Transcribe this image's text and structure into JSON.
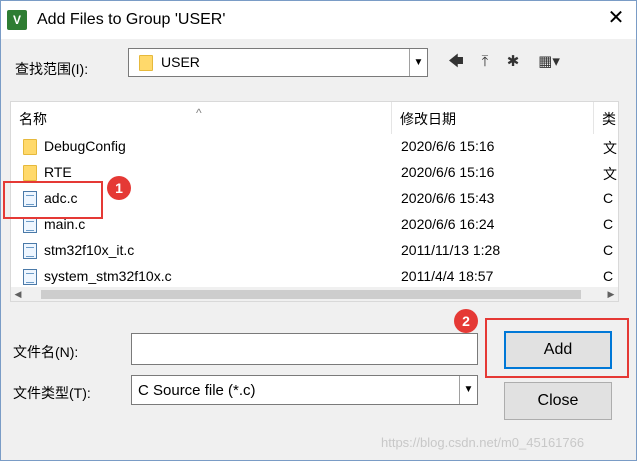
{
  "window": {
    "title": "Add Files to Group 'USER'",
    "close_glyph": "✕",
    "app_icon_glyph": "V"
  },
  "lookin": {
    "label": "查找范围(I):",
    "value": "USER",
    "arrow": "▼"
  },
  "toolbar": {
    "back_glyph": "🡄",
    "up_glyph": "⤒",
    "new_folder_glyph": "✱",
    "view_glyph": "▦▾"
  },
  "list": {
    "headers": {
      "name": "名称",
      "date": "修改日期",
      "type": "类"
    },
    "sort_indicator": "^",
    "rows": [
      {
        "icon": "folder-icon",
        "name": "DebugConfig",
        "date": "2020/6/6 15:16",
        "type": "文"
      },
      {
        "icon": "folder-icon",
        "name": "RTE",
        "date": "2020/6/6 15:16",
        "type": "文"
      },
      {
        "icon": "c-file-icon",
        "name": "adc.c",
        "date": "2020/6/6 15:43",
        "type": "C"
      },
      {
        "icon": "c-file-icon",
        "name": "main.c",
        "date": "2020/6/6 16:24",
        "type": "C"
      },
      {
        "icon": "c-file-icon",
        "name": "stm32f10x_it.c",
        "date": "2011/11/13 1:28",
        "type": "C"
      },
      {
        "icon": "c-file-icon",
        "name": "system_stm32f10x.c",
        "date": "2011/4/4 18:57",
        "type": "C"
      }
    ],
    "scroll_left": "◀",
    "scroll_right": "▶"
  },
  "filename": {
    "label": "文件名(N):",
    "value": ""
  },
  "filetype": {
    "label": "文件类型(T):",
    "value": "C Source file (*.c)",
    "arrow": "▼"
  },
  "buttons": {
    "add": "Add",
    "close": "Close"
  },
  "annotations": {
    "badge1": "1",
    "badge2": "2",
    "color": "#e53935"
  },
  "watermark": "https://blog.csdn.net/m0_45161766"
}
